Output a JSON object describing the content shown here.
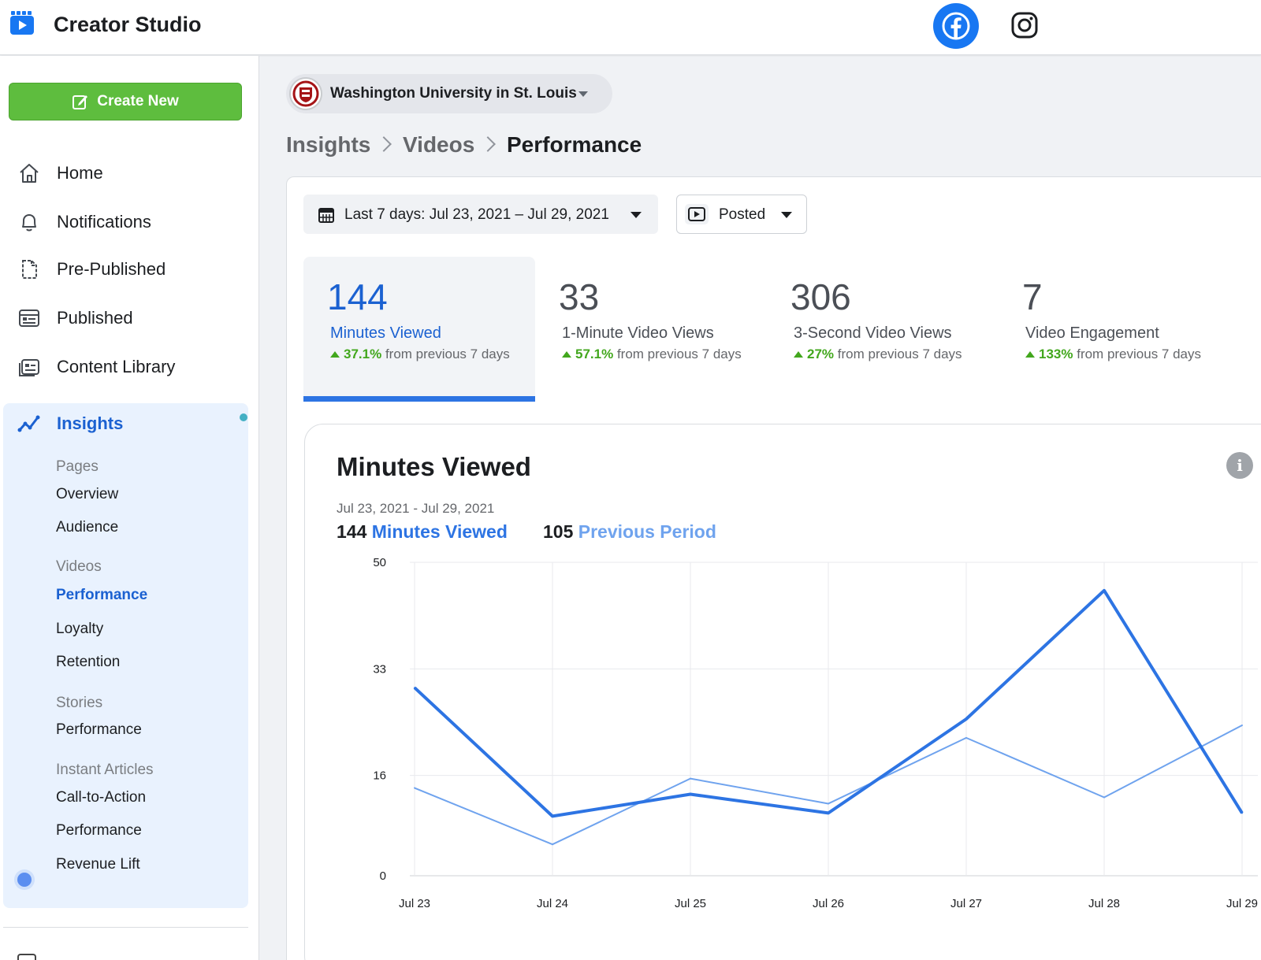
{
  "app": {
    "title": "Creator Studio"
  },
  "sidebar": {
    "create_label": "Create New",
    "nav": [
      {
        "label": "Home",
        "icon": "home-icon"
      },
      {
        "label": "Notifications",
        "icon": "bell-icon"
      },
      {
        "label": "Pre-Published",
        "icon": "draft-doc-icon"
      },
      {
        "label": "Published",
        "icon": "published-icon"
      },
      {
        "label": "Content Library",
        "icon": "content-library-icon"
      }
    ],
    "insights": {
      "label": "Insights",
      "groups": [
        {
          "title": "Pages",
          "items": [
            "Overview",
            "Audience"
          ]
        },
        {
          "title": "Videos",
          "items": [
            "Performance",
            "Loyalty",
            "Retention"
          ]
        },
        {
          "title": "Stories",
          "items": [
            "Performance"
          ]
        },
        {
          "title": "Instant Articles",
          "items": [
            "Call-to-Action",
            "Performance",
            "Revenue Lift"
          ]
        }
      ],
      "active_item": "Videos > Performance"
    }
  },
  "page_selector": {
    "name": "Washington University in St. Louis"
  },
  "breadcrumb": [
    "Insights",
    "Videos",
    "Performance"
  ],
  "filters": {
    "date_range": "Last 7 days: Jul 23, 2021 – Jul 29, 2021",
    "post_type": "Posted"
  },
  "metrics": [
    {
      "value": "144",
      "name": "Minutes Viewed",
      "delta": "37.1%",
      "delta_suffix": "from previous 7 days",
      "active": true
    },
    {
      "value": "33",
      "name": "1-Minute Video Views",
      "delta": "57.1%",
      "delta_suffix": "from previous 7 days",
      "active": false
    },
    {
      "value": "306",
      "name": "3-Second Video Views",
      "delta": "27%",
      "delta_suffix": "from previous 7 days",
      "active": false
    },
    {
      "value": "7",
      "name": "Video Engagement",
      "delta": "133%",
      "delta_suffix": "from previous 7 days",
      "active": false
    }
  ],
  "chart_panel": {
    "title": "Minutes Viewed",
    "range": "Jul 23, 2021 - Jul 29, 2021",
    "current_total": "144",
    "current_label": "Minutes Viewed",
    "previous_total": "105",
    "previous_label": "Previous Period"
  },
  "colors": {
    "accent": "#1b61d1",
    "current_series": "#2d74e3",
    "previous_series": "#6fa3ee",
    "positive": "#42a71d",
    "create_button": "#5ebd3e"
  },
  "chart_data": {
    "type": "line",
    "categories": [
      "Jul 23",
      "Jul 24",
      "Jul 25",
      "Jul 26",
      "Jul 27",
      "Jul 28",
      "Jul 29"
    ],
    "yticks": [
      "0",
      "16",
      "33",
      "50"
    ],
    "ylim": [
      0,
      50
    ],
    "grid": true,
    "series": [
      {
        "name": "Minutes Viewed",
        "values": [
          30,
          9.5,
          13,
          10,
          25,
          45.5,
          10
        ]
      },
      {
        "name": "Previous Period",
        "values": [
          14,
          5,
          15.5,
          11.5,
          22,
          12.5,
          24
        ]
      }
    ]
  }
}
